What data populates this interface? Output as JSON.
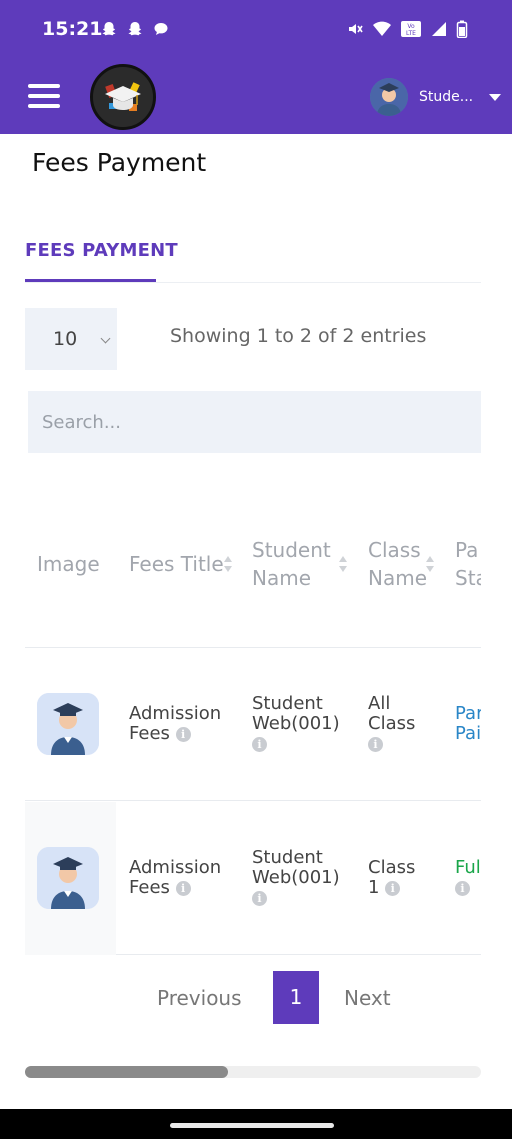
{
  "status_bar": {
    "time": "15:21",
    "notification_icons": [
      "snapchat-icon",
      "snapchat-icon",
      "chat-bubble-icon"
    ],
    "system_icons": [
      "mute-icon",
      "wifi-icon",
      "volte-icon",
      "signal-icon",
      "battery-icon"
    ],
    "volte_text": "Vo LTE"
  },
  "app_bar": {
    "background": "#5e3bbb",
    "user_name": "Stude..."
  },
  "page": {
    "title": "Fees Payment"
  },
  "tabs": [
    {
      "label": "FEES PAYMENT",
      "active": true
    }
  ],
  "table_controls": {
    "page_length": "10",
    "info": "Showing 1 to 2 of 2 entries",
    "search_placeholder": "Search..."
  },
  "table": {
    "columns": [
      {
        "line1": "Image",
        "line2": ""
      },
      {
        "line1": "Fees Title",
        "line2": ""
      },
      {
        "line1": "Student",
        "line2": "Name"
      },
      {
        "line1": "Class",
        "line2": "Name"
      },
      {
        "line1": "Pa",
        "line2": "Sta"
      }
    ],
    "rows": [
      {
        "fees_title_1": "Admission",
        "fees_title_2": "Fees",
        "student_1": "Student",
        "student_2": "Web(001)",
        "class_1": "All",
        "class_2": "Class",
        "status_1": "Par",
        "status_2": "Pai",
        "status_color": "#2a86c7"
      },
      {
        "fees_title_1": "Admission",
        "fees_title_2": "Fees",
        "student_1": "Student",
        "student_2": "Web(001)",
        "class_1": "Class",
        "class_2": "1",
        "status_1": "Ful",
        "status_2": "",
        "status_color": "#1aa64a"
      }
    ]
  },
  "pagination": {
    "previous": "Previous",
    "current": "1",
    "next": "Next"
  },
  "colors": {
    "accent": "#5e3bbb",
    "status_partial": "#2a86c7",
    "status_full": "#1aa64a"
  }
}
